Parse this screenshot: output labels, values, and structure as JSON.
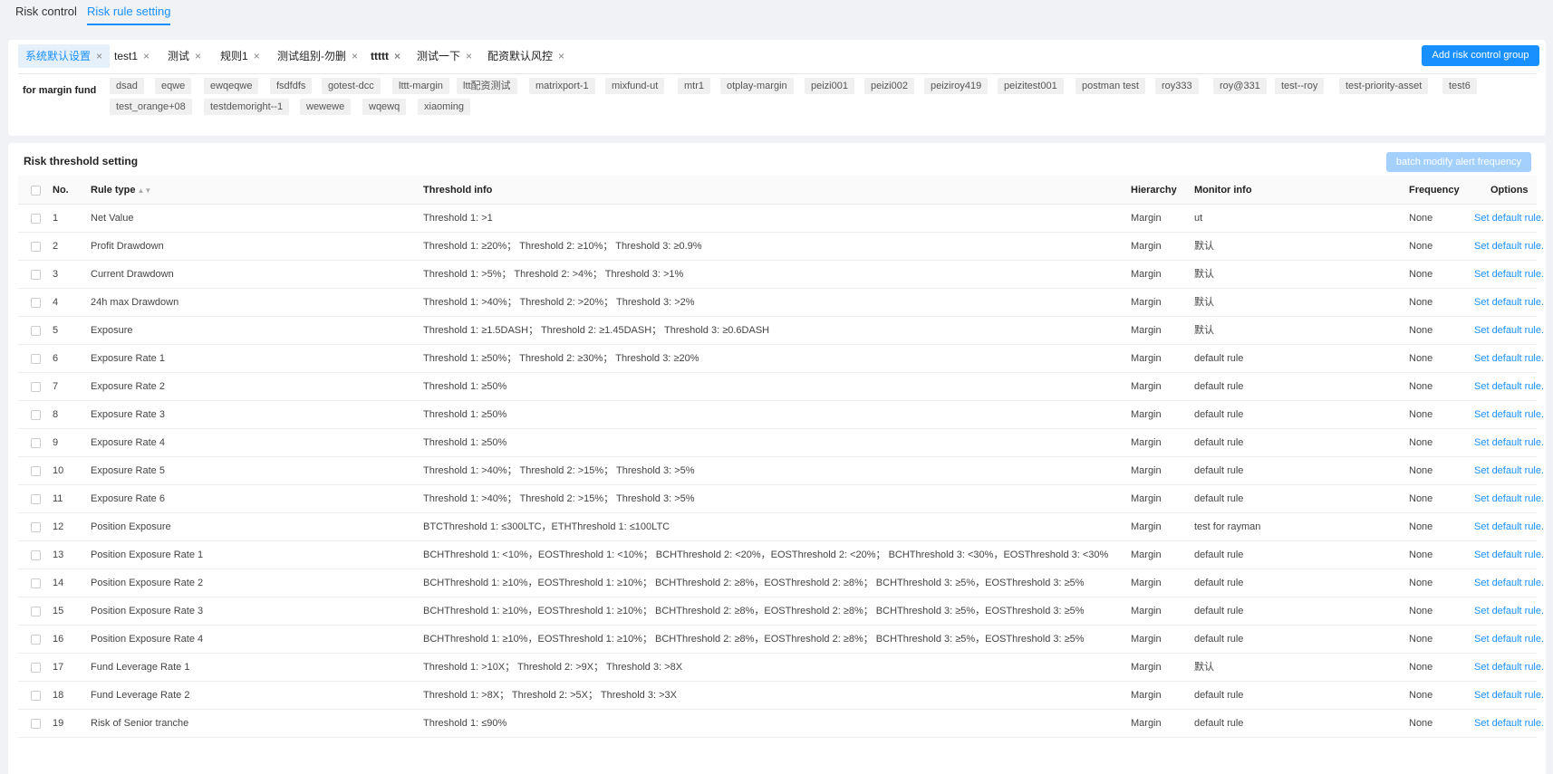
{
  "nav": {
    "tabs": [
      {
        "label": "Risk control"
      },
      {
        "label": "Risk rule setting"
      }
    ]
  },
  "groups": {
    "tabs": [
      {
        "label": "系统默认设置"
      },
      {
        "label": "test1"
      },
      {
        "label": "测试"
      },
      {
        "label": "规则1"
      },
      {
        "label": "测试组别-勿删"
      },
      {
        "label": "ttttt"
      },
      {
        "label": "测试一下"
      },
      {
        "label": "配资默认风控"
      }
    ],
    "close_glyph": "×",
    "add_button": "Add risk control group",
    "fund_label": "for margin fund",
    "funds": [
      "dsad",
      "eqwe",
      "ewqeqwe",
      "fsdfdfs",
      "gotest-dcc",
      "lttt-margin",
      "ltt配资测试",
      "matrixport-1",
      "mixfund-ut",
      "mtr1",
      "otplay-margin",
      "peizi001",
      "peizi002",
      "peiziroy419",
      "peizitest001",
      "postman test",
      "roy333",
      "roy@331",
      "test--roy",
      "test-priority-asset",
      "test6",
      "test_orange+08",
      "testdemoright--1",
      "wewewe",
      "wqewq",
      "xiaoming"
    ]
  },
  "table": {
    "title": "Risk threshold setting",
    "batch_button": "batch modify alert frequency",
    "headers": {
      "no": "No.",
      "rule_type": "Rule type",
      "sort_glyph": "▲▼",
      "threshold": "Threshold info",
      "hierarchy": "Hierarchy",
      "monitor": "Monitor info",
      "frequency": "Frequency",
      "options": "Options"
    },
    "rows": [
      {
        "no": "1",
        "type": "Net Value",
        "threshold": "Threshold 1: >1",
        "hier": "Margin",
        "monitor": "ut",
        "freq": "None",
        "option": "Set default rule."
      },
      {
        "no": "2",
        "type": "Profit Drawdown",
        "threshold": "Threshold 1: ≥20%；  Threshold 2: ≥10%；  Threshold 3: ≥0.9%",
        "hier": "Margin",
        "monitor": "默认",
        "freq": "None",
        "option": "Set default rule."
      },
      {
        "no": "3",
        "type": "Current Drawdown",
        "threshold": "Threshold 1: >5%；  Threshold 2: >4%；  Threshold 3: >1%",
        "hier": "Margin",
        "monitor": "默认",
        "freq": "None",
        "option": "Set default rule."
      },
      {
        "no": "4",
        "type": "24h max Drawdown",
        "threshold": "Threshold 1: >40%；  Threshold 2: >20%；  Threshold 3: >2%",
        "hier": "Margin",
        "monitor": "默认",
        "freq": "None",
        "option": "Set default rule."
      },
      {
        "no": "5",
        "type": "Exposure",
        "threshold": "Threshold 1: ≥1.5DASH；  Threshold 2: ≥1.45DASH；  Threshold 3: ≥0.6DASH",
        "hier": "Margin",
        "monitor": "默认",
        "freq": "None",
        "option": "Set default rule."
      },
      {
        "no": "6",
        "type": "Exposure Rate 1",
        "threshold": "Threshold 1: ≥50%；  Threshold 2: ≥30%；  Threshold 3: ≥20%",
        "hier": "Margin",
        "monitor": "default rule",
        "freq": "None",
        "option": "Set default rule."
      },
      {
        "no": "7",
        "type": "Exposure Rate 2",
        "threshold": "Threshold 1: ≥50%",
        "hier": "Margin",
        "monitor": "default rule",
        "freq": "None",
        "option": "Set default rule."
      },
      {
        "no": "8",
        "type": "Exposure Rate 3",
        "threshold": "Threshold 1: ≥50%",
        "hier": "Margin",
        "monitor": "default rule",
        "freq": "None",
        "option": "Set default rule."
      },
      {
        "no": "9",
        "type": "Exposure Rate 4",
        "threshold": "Threshold 1: ≥50%",
        "hier": "Margin",
        "monitor": "default rule",
        "freq": "None",
        "option": "Set default rule."
      },
      {
        "no": "10",
        "type": "Exposure Rate 5",
        "threshold": "Threshold 1: >40%；  Threshold 2: >15%；  Threshold 3: >5%",
        "hier": "Margin",
        "monitor": "default rule",
        "freq": "None",
        "option": "Set default rule."
      },
      {
        "no": "11",
        "type": "Exposure Rate 6",
        "threshold": "Threshold 1: >40%；  Threshold 2: >15%；  Threshold 3: >5%",
        "hier": "Margin",
        "monitor": "default rule",
        "freq": "None",
        "option": "Set default rule."
      },
      {
        "no": "12",
        "type": "Position Exposure",
        "threshold": "BTCThreshold 1: ≤300LTC，ETHThreshold 1: ≤100LTC",
        "hier": "Margin",
        "monitor": "test for rayman",
        "freq": "None",
        "option": "Set default rule."
      },
      {
        "no": "13",
        "type": "Position Exposure Rate 1",
        "threshold": "BCHThreshold 1: <10%，EOSThreshold 1: <10%；  BCHThreshold 2: <20%，EOSThreshold 2: <20%；  BCHThreshold 3: <30%，EOSThreshold 3: <30%",
        "hier": "Margin",
        "monitor": "default rule",
        "freq": "None",
        "option": "Set default rule."
      },
      {
        "no": "14",
        "type": "Position Exposure Rate 2",
        "threshold": "BCHThreshold 1: ≥10%，EOSThreshold 1: ≥10%；  BCHThreshold 2: ≥8%，EOSThreshold 2: ≥8%；  BCHThreshold 3: ≥5%，EOSThreshold 3: ≥5%",
        "hier": "Margin",
        "monitor": "default rule",
        "freq": "None",
        "option": "Set default rule."
      },
      {
        "no": "15",
        "type": "Position Exposure Rate 3",
        "threshold": "BCHThreshold 1: ≥10%，EOSThreshold 1: ≥10%；  BCHThreshold 2: ≥8%，EOSThreshold 2: ≥8%；  BCHThreshold 3: ≥5%，EOSThreshold 3: ≥5%",
        "hier": "Margin",
        "monitor": "default rule",
        "freq": "None",
        "option": "Set default rule."
      },
      {
        "no": "16",
        "type": "Position Exposure Rate 4",
        "threshold": "BCHThreshold 1: ≥10%，EOSThreshold 1: ≥10%；  BCHThreshold 2: ≥8%，EOSThreshold 2: ≥8%；  BCHThreshold 3: ≥5%，EOSThreshold 3: ≥5%",
        "hier": "Margin",
        "monitor": "default rule",
        "freq": "None",
        "option": "Set default rule."
      },
      {
        "no": "17",
        "type": "Fund Leverage Rate 1",
        "threshold": "Threshold 1: >10X；  Threshold 2: >9X；  Threshold 3: >8X",
        "hier": "Margin",
        "monitor": "默认",
        "freq": "None",
        "option": "Set default rule."
      },
      {
        "no": "18",
        "type": "Fund Leverage Rate 2",
        "threshold": "Threshold 1: >8X；  Threshold 2: >5X；  Threshold 3: >3X",
        "hier": "Margin",
        "monitor": "default rule",
        "freq": "None",
        "option": "Set default rule."
      },
      {
        "no": "19",
        "type": "Risk of Senior tranche",
        "threshold": "Threshold 1: ≤90%",
        "hier": "Margin",
        "monitor": "default rule",
        "freq": "None",
        "option": "Set default rule."
      }
    ]
  }
}
